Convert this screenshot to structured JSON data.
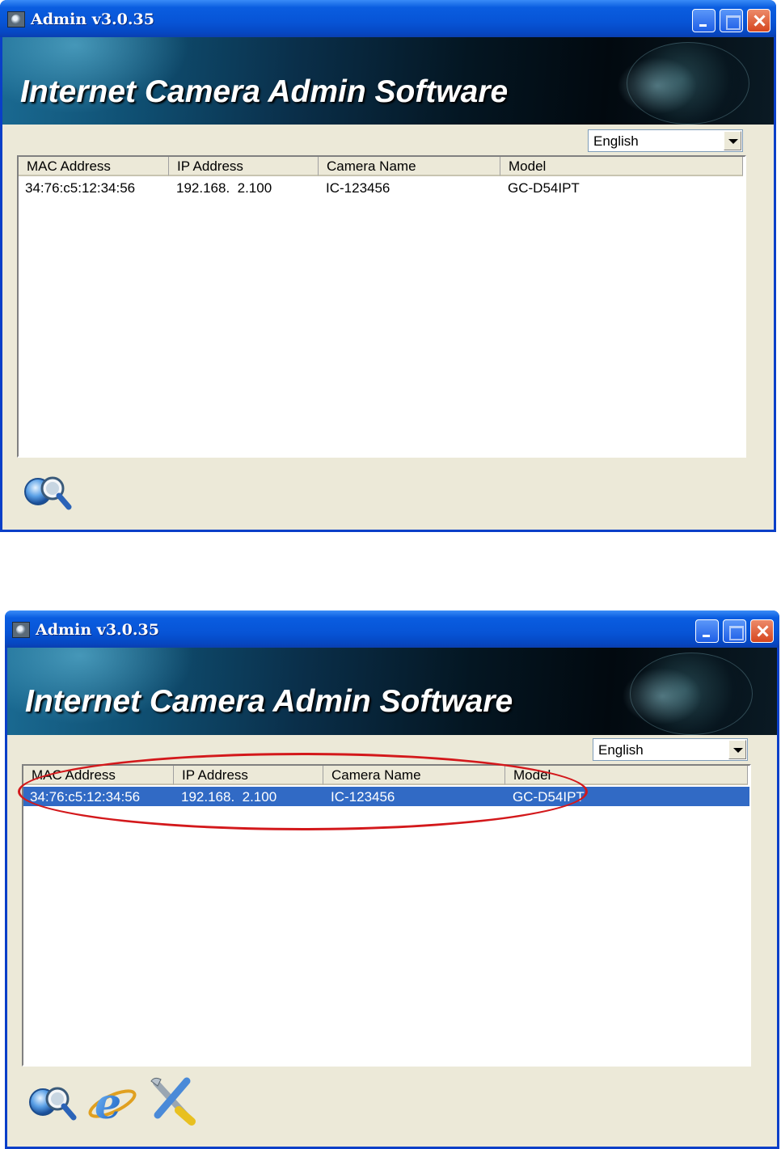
{
  "windows": [
    {
      "title": "Admin v3.0.35",
      "banner": "Internet Camera Admin Software",
      "language": "English",
      "columns": [
        "MAC Address",
        "IP Address",
        "Camera Name",
        "Model"
      ],
      "rows": [
        {
          "mac": "34:76:c5:12:34:56",
          "ip": "192.168.  2.100",
          "name": "IC-123456",
          "model": "GC-D54IPT",
          "selected": false
        }
      ],
      "toolbar": [
        "search-camera-icon"
      ]
    },
    {
      "title": "Admin v3.0.35",
      "banner": "Internet Camera Admin Software",
      "language": "English",
      "columns": [
        "MAC Address",
        "IP Address",
        "Camera Name",
        "Model"
      ],
      "rows": [
        {
          "mac": "34:76:c5:12:34:56",
          "ip": "192.168.  2.100",
          "name": "IC-123456",
          "model": "GC-D54IPT",
          "selected": true
        }
      ],
      "toolbar": [
        "search-camera-icon",
        "internet-explorer-icon",
        "setup-tools-icon"
      ]
    }
  ],
  "colors": {
    "titlebar": "#0754d6",
    "selection": "#316ac5",
    "annotation": "#d3181b"
  }
}
